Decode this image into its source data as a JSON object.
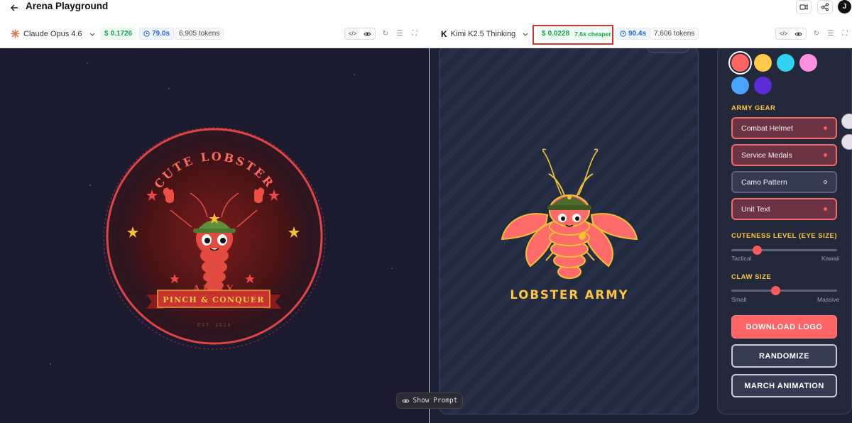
{
  "app": {
    "title": "Arena Playground",
    "avatar_initial": "J"
  },
  "left_model": {
    "name": "Claude Opus 4.6",
    "cost": "0.1726",
    "time": "79.0s",
    "tokens": "6,905 tokens"
  },
  "right_model": {
    "name": "Kimi K2.5 Thinking",
    "cost": "0.0228",
    "cheaper": "7.6x cheaper",
    "time": "90.4s",
    "tokens": "7,606 tokens"
  },
  "currency_symbol": "$",
  "show_prompt": "Show Prompt",
  "left_logo": {
    "arc_text": "CUTE LOBSTER",
    "army_text": "ARMY",
    "banner_text": "PINCH & CONQUER",
    "est_text": "EST. 2024"
  },
  "right_logo": {
    "title": "LOBSTER ARMY"
  },
  "sidebar": {
    "colors": [
      "#ff6464",
      "#ffc94a",
      "#2fd3f0",
      "#ff8fe0",
      "#4aa3ff",
      "#5a2bd6"
    ],
    "army_gear_label": "ARMY GEAR",
    "gear": [
      {
        "label": "Combat Helmet",
        "on": true
      },
      {
        "label": "Service Medals",
        "on": true
      },
      {
        "label": "Camo Pattern",
        "on": false
      },
      {
        "label": "Unit Text",
        "on": true
      }
    ],
    "cuteness": {
      "label": "CUTENESS LEVEL (EYE SIZE)",
      "min": "Tactical",
      "max": "Kawaii",
      "value": 0.22
    },
    "claw": {
      "label": "CLAW SIZE",
      "min": "Small",
      "max": "Massive",
      "value": 0.41
    },
    "buttons": {
      "download": "DOWNLOAD LOGO",
      "randomize": "RANDOMIZE",
      "march": "MARCH ANIMATION"
    }
  }
}
